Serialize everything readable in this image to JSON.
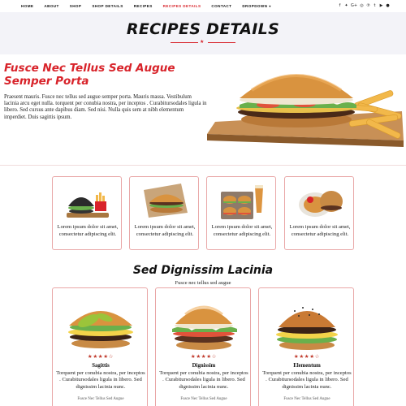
{
  "nav": {
    "items": [
      "HOME",
      "ABOUT",
      "SHOP",
      "SHOP DETAILS",
      "RECIPES",
      "RECIPES DETAILS",
      "CONTACT",
      "DROPDOWN"
    ],
    "active_index": 5,
    "dropdown_caret": "▾"
  },
  "social": {
    "icons": [
      "facebook-icon",
      "twitter-icon",
      "google-plus-icon",
      "instagram-icon",
      "pinterest-icon",
      "tumblr-icon",
      "youtube-icon",
      "user-icon"
    ],
    "glyphs": [
      "f",
      "✦",
      "G+",
      "◎",
      "℗",
      "t",
      "▶",
      "●"
    ]
  },
  "header": {
    "title": "RECIPES DETAILS",
    "accent_color": "#d8232a"
  },
  "intro": {
    "heading": "Fusce Nec Tellus Sed Augue Semper Porta",
    "body": "Praesent mauris. Fusce nec tellus sed augue semper porta. Mauris massa. Vestibulum lacinia arcu eget nulla. torquent per conubia nostra, per inceptos . Curabitursodales ligula in libero. Sed cursus ante dapibus diam. Sed nisi. Nulla quis sem at nibh elementum imperdiet. Duis sagittis ipsum."
  },
  "small_cards": [
    {
      "caption": "Lorem ipsum dolor sit amet, consectetur adipiscing elit."
    },
    {
      "caption": "Lorem ipsum dolor sit amet, consectetur adipiscing elit."
    },
    {
      "caption": "Lorem ipsum dolor sit amet, consectetur adipiscing elit."
    },
    {
      "caption": "Lorem ipsum dolor sit amet, consectetur adipiscing elit."
    }
  ],
  "section": {
    "title": "Sed Dignissim Lacinia",
    "subtitle": "Fusce nec tellus sed augue"
  },
  "big_cards": [
    {
      "name": "Sagittis",
      "rating": 3.5,
      "stars_text": "★★★★☆",
      "desc": "Torquent per conubia nostra, per inceptos . Curabitursodales ligula in libero. Sed dignissim lacinia nunc.",
      "footer": "Fusce Nec Tellus Sed Augue"
    },
    {
      "name": "Dignissim",
      "rating": 3.5,
      "stars_text": "★★★★☆",
      "desc": "Torquent per conubia nostra, per inceptos . Curabitursodales ligula in libero. Sed dignissim lacinia nunc.",
      "footer": "Fusce Nec Tellus Sed Augue"
    },
    {
      "name": "Elementum",
      "rating": 3.5,
      "stars_text": "★★★★☆",
      "desc": "Torquent per conubia nostra, per inceptos . Curabitursodales ligula in libero. Sed dignissim lacinia nunc.",
      "footer": "Fusce Nec Tellus Sed Augue"
    }
  ]
}
